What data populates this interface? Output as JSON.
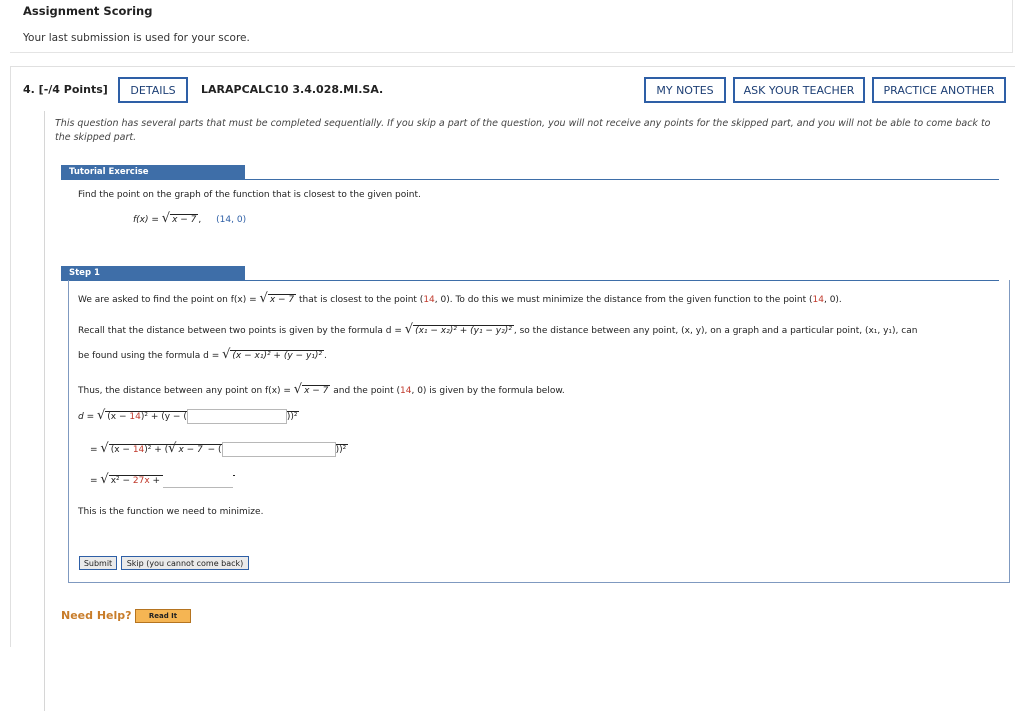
{
  "header": {
    "title": "Assignment Scoring",
    "subtitle": "Your last submission is used for your score."
  },
  "question": {
    "number_points": "4.  [-/4 Points]",
    "details_label": "DETAILS",
    "code": "LARAPCALC10 3.4.028.MI.SA.",
    "my_notes_label": "MY NOTES",
    "ask_teacher_label": "ASK YOUR TEACHER",
    "practice_label": "PRACTICE ANOTHER",
    "note": "This question has several parts that must be completed sequentially. If you skip a part of the question, you will not receive any points for the skipped part, and you will not be able to come back to the skipped part."
  },
  "tutorial": {
    "tab_label": "Tutorial Exercise",
    "instruction": "Find the point on the graph of the function that is closest to the given point.",
    "function_lhs": "f(x) = ",
    "function_rad": "x − 7",
    "function_tail": ",",
    "point": "(14, 0)"
  },
  "step": {
    "tab_label": "Step 1",
    "line1_a": "We are asked to find the point on f(x) = ",
    "line1_rad": "x − 7",
    "line1_b": " that is closest to the point (",
    "line1_pt_x": "14",
    "line1_c": ", 0). To do this we must minimize the distance from the given function to the point (",
    "line1_pt2_x": "14",
    "line1_d": ", 0).",
    "line2_a": "Recall that the distance between two points is given by the formula d = ",
    "line2_rad": "(x₁ − x₂)² + (y₁ − y₂)²",
    "line2_b": ", so the distance between any point, (x, y), on a graph and a particular point, (x₁, y₁), can",
    "line3_a": "be found using the formula d = ",
    "line3_rad": "(x − x₁)² + (y − y₁)²",
    "line3_b": ".",
    "line4_a": "Thus, the distance between any point on f(x) = ",
    "line4_rad": "x − 7",
    "line4_b": " and the point (",
    "line4_pt_x": "14",
    "line4_c": ", 0) is given by the formula below.",
    "eq1_prefix": "d = ",
    "eq1_a": "(x − ",
    "eq1_num": "14",
    "eq1_b": ")² + (y − (",
    "eq1_end": "))²",
    "eq2_prefix": "= ",
    "eq2_a": "(x − ",
    "eq2_num": "14",
    "eq2_b": ")² + (",
    "eq2_inner_rad": "x − 7",
    "eq2_c": " − (",
    "eq2_end": "))²",
    "eq3_prefix": "= ",
    "eq3_a": "x² − ",
    "eq3_num": "27x",
    "eq3_b": " + ",
    "closing": "This is the function we need to minimize.",
    "submit_label": "Submit",
    "skip_label": "Skip (you cannot come back)"
  },
  "help": {
    "need_help": "Need Help?",
    "read_it": "Read It"
  },
  "colors": {
    "accent_blue": "#2e5fa6",
    "tab_blue": "#3e6ea8",
    "red": "#c0392b",
    "orange": "#c87d2b"
  }
}
